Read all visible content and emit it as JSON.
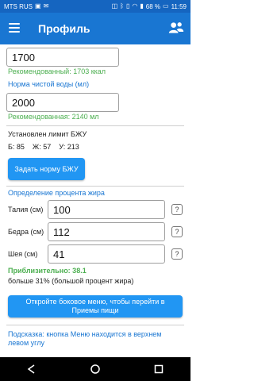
{
  "status_bar": {
    "carrier": "MTS RUS",
    "battery": "68 %",
    "time": "11:59"
  },
  "app_bar": {
    "title": "Профиль"
  },
  "calories": {
    "value": "1700",
    "recommended": "Рекомендованный: 1703 ккал"
  },
  "water": {
    "label": "Норма чистой воды (мл)",
    "value": "2000",
    "recommended": "Рекомендованная: 2140 мл"
  },
  "bju": {
    "title": "Установлен лимит БЖУ",
    "protein": "Б: 85",
    "fat": "Ж: 57",
    "carbs": "У: 213",
    "button_label": "Задать норму БЖУ"
  },
  "fat_percent": {
    "title": "Определение процента жира",
    "waist_label": "Талия (см)",
    "waist_value": "100",
    "hips_label": "Бедра (см)",
    "hips_value": "112",
    "neck_label": "Шея (см)",
    "neck_value": "41",
    "help_symbol": "?",
    "result": "Приблизительно: 38.1",
    "result_desc": "больше 31% (большой процент жира)"
  },
  "menu_button_label": "Откройте боковое меню, чтобы перейти в Приемы пищи",
  "tip": "Подсказка: кнопка Меню находится в верхнем левом углу",
  "colors": {
    "primary": "#1976d2",
    "status_bar": "#1565c0",
    "button": "#2196f3",
    "success": "#4caf50"
  }
}
